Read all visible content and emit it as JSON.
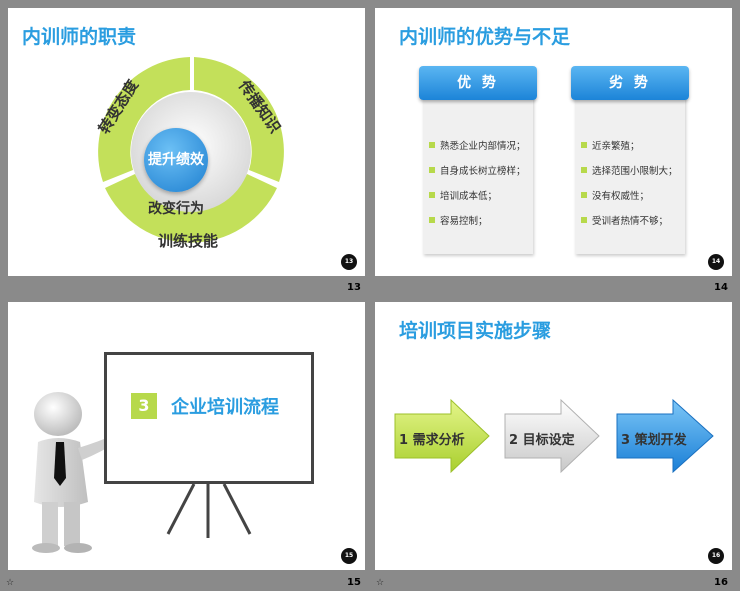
{
  "slides": [
    {
      "title": "内训师的职责",
      "ring_labels": [
        "转变态度",
        "传播知识",
        "训练技能"
      ],
      "center": "提升绩效",
      "center_bottom": "改变行为",
      "page_badge": "13",
      "thumb_number": "13"
    },
    {
      "title": "内训师的优势与不足",
      "columns": [
        {
          "header": "优 势",
          "items": [
            "熟悉企业内部情况；",
            "自身成长树立榜样；",
            "培训成本低；",
            "容易控制；"
          ]
        },
        {
          "header": "劣 势",
          "items": [
            "近亲繁殖；",
            "选择范围小限制大；",
            "没有权威性；",
            "受训者热情不够；"
          ]
        }
      ],
      "page_badge": "14",
      "thumb_number": "14"
    },
    {
      "board_number": "3",
      "board_text": "企业培训流程",
      "page_badge": "15",
      "thumb_number": "15",
      "star": "☆"
    },
    {
      "title": "培训项目实施步骤",
      "steps": [
        "1 需求分析",
        "2 目标设定",
        "3 策划开发"
      ],
      "page_badge": "16",
      "thumb_number": "16",
      "star": "☆"
    }
  ],
  "colors": {
    "accent_blue": "#2a9de0",
    "accent_green": "#b7d94b",
    "background": "#8a8a8a"
  }
}
